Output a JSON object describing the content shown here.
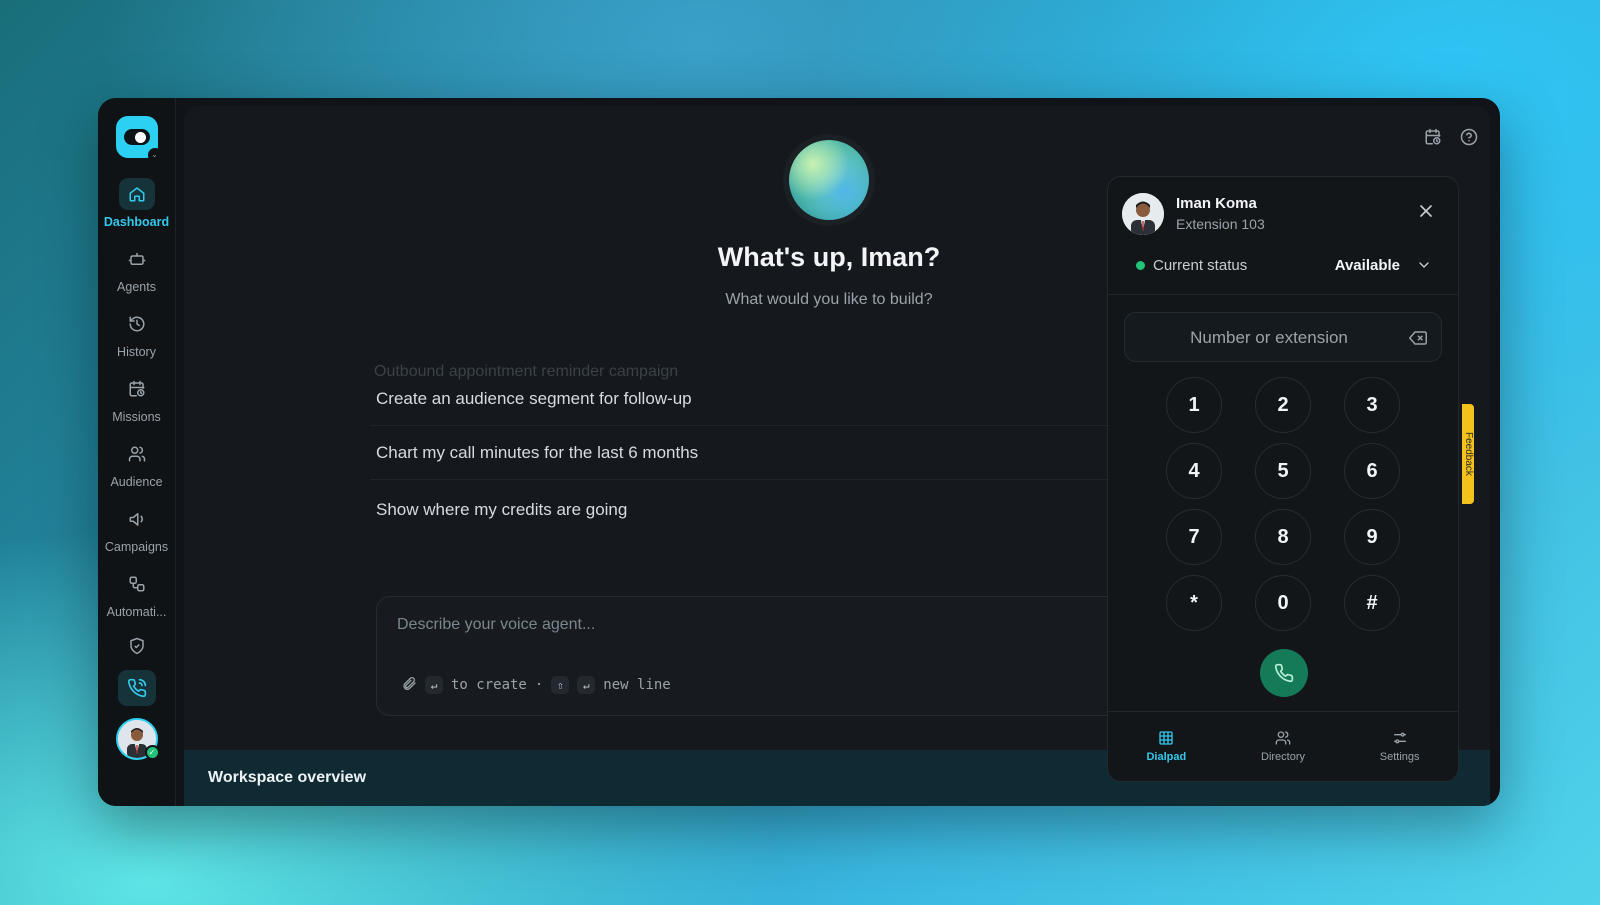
{
  "sidebar": {
    "items": [
      {
        "label": "Dashboard",
        "icon": "home-icon",
        "active": true
      },
      {
        "label": "Agents",
        "icon": "robot-icon"
      },
      {
        "label": "History",
        "icon": "history-icon"
      },
      {
        "label": "Missions",
        "icon": "calendar-clock-icon"
      },
      {
        "label": "Audience",
        "icon": "users-icon"
      },
      {
        "label": "Campaigns",
        "icon": "megaphone-icon"
      },
      {
        "label": "Automati...",
        "icon": "workflow-icon"
      }
    ]
  },
  "main": {
    "greeting": "What's up, Iman?",
    "subtitle": "What would you like to build?",
    "ghost_suggestion": "Outbound appointment reminder campaign",
    "suggestions": [
      "Create an audience segment for follow-up",
      "Chart my call minutes for the last 6 months",
      "Show where my credits are going"
    ],
    "composer": {
      "placeholder": "Describe your voice agent...",
      "hint_create": "to create",
      "hint_newline": "new line",
      "hint_separator": "·"
    },
    "footer_title": "Workspace overview"
  },
  "feedback_label": "Feedback",
  "dialer": {
    "user_name": "Iman Koma",
    "extension": "Extension 103",
    "status_label": "Current status",
    "status_value": "Available",
    "input_placeholder": "Number or extension",
    "keys": [
      "1",
      "2",
      "3",
      "4",
      "5",
      "6",
      "7",
      "8",
      "9",
      "*",
      "0",
      "#"
    ],
    "tabs": [
      {
        "label": "Dialpad",
        "active": true
      },
      {
        "label": "Directory"
      },
      {
        "label": "Settings"
      }
    ]
  },
  "colors": {
    "accent": "#34c9ec",
    "status_green": "#22c278",
    "call_button": "#147a57",
    "feedback_tab": "#f4c21a"
  }
}
